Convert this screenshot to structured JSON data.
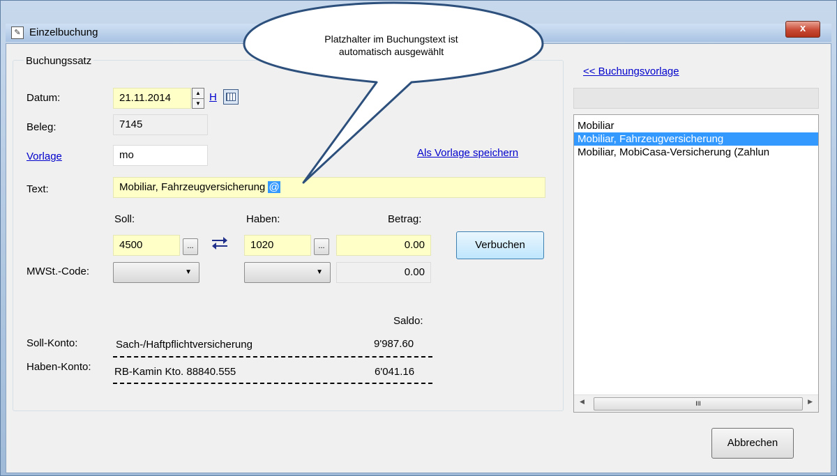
{
  "window": {
    "title": "Einzelbuchung",
    "close_label": "x"
  },
  "callout": {
    "line1": "Platzhalter im Buchungstext ist",
    "line2": "automatisch ausgewählt"
  },
  "group": {
    "legend": "Buchungssatz"
  },
  "datum": {
    "label": "Datum:",
    "value": "21.11.2014",
    "h_link": "H"
  },
  "beleg": {
    "label": "Beleg:",
    "value": "7145"
  },
  "vorlage": {
    "label": "Vorlage",
    "value": "mo",
    "save_link": "Als Vorlage speichern"
  },
  "text": {
    "label": "Text:",
    "value": "Mobiliar, Fahrzeugversicherung ",
    "placeholder_selected": "@"
  },
  "soll": {
    "label": "Soll:",
    "value": "4500",
    "browse": "..."
  },
  "haben": {
    "label": "Haben:",
    "value": "1020",
    "browse": "..."
  },
  "betrag": {
    "label": "Betrag:",
    "value": "0.00",
    "mwst_value": "0.00"
  },
  "mwst": {
    "label": "MWSt.-Code:"
  },
  "buttons": {
    "verbuchen": "Verbuchen",
    "abbrechen": "Abbrechen"
  },
  "saldo": {
    "header": "Saldo:",
    "soll_label": "Soll-Konto:",
    "soll_name": "Sach-/Haftpflichtversicherung",
    "soll_value": "9'987.60",
    "haben_label": "Haben-Konto:",
    "haben_name": "RB-Kamin Kto. 88840.555",
    "haben_value": "6'041.16"
  },
  "sidebar": {
    "link": "<< Buchungsvorlage",
    "items": [
      {
        "label": "Mobiliar",
        "selected": false
      },
      {
        "label": "Mobiliar, Fahrzeugversicherung",
        "selected": true
      },
      {
        "label": "Mobiliar, MobiCasa-Versicherung (Zahlun",
        "selected": false
      }
    ],
    "scroll_thumb": "III"
  }
}
